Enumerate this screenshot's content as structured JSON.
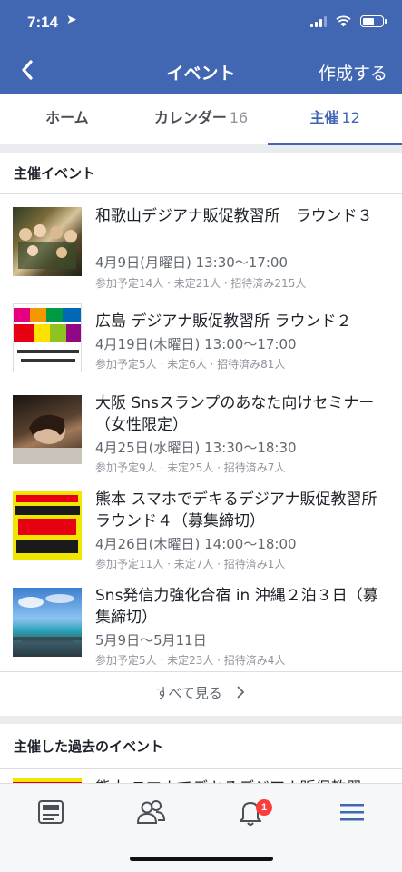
{
  "status": {
    "time": "7:14"
  },
  "nav": {
    "title": "イベント",
    "create": "作成する"
  },
  "tabs": [
    {
      "label": "ホーム",
      "count": ""
    },
    {
      "label": "カレンダー",
      "count": "16"
    },
    {
      "label": "主催",
      "count": "12"
    }
  ],
  "hosted": {
    "header": "主催イベント",
    "events": [
      {
        "title": "和歌山デジアナ販促教習所　ラウンド３",
        "date": "4月9日(月曜日) 13:30～17:00",
        "meta": "参加予定14人 · 未定21人 · 招待済み215人",
        "thumb_text": ""
      },
      {
        "title": "広島 デジアナ販促教習所 ラウンド２",
        "date": "4月19日(木曜日) 13:00～17:00",
        "meta": "参加予定5人 · 未定6人 · 招待済み81人",
        "thumb_text": "広島デジアナ販促教習所 Training School"
      },
      {
        "title": "大阪 Snsスランプのあなた向けセミナー（女性限定）",
        "date": "4月25日(水曜日) 13:30～18:30",
        "meta": "参加予定9人 · 未定25人 · 招待済み7人",
        "thumb_text": ""
      },
      {
        "title": "熊本 スマホでデキるデジアナ販促教習所 ラウンド４（募集締切）",
        "date": "4月26日(木曜日) 14:00～18:00",
        "meta": "参加予定11人 · 未定7人 · 招待済み1人",
        "thumb_text": "SNS初心者必見 スマホだけでできる簡単集客"
      },
      {
        "title": "Sns発信力強化合宿 in 沖縄２泊３日（募集締切）",
        "date": "5月9日～5月11日",
        "meta": "参加予定5人 · 未定23人 · 招待済み4人",
        "thumb_text": ""
      }
    ],
    "see_all": "すべて見る"
  },
  "past": {
    "header": "主催した過去のイベント",
    "partial_title": "熊本 スマホでデキるデジアナ販促教習"
  },
  "bottom_nav": {
    "notification_badge": "1",
    "icons": [
      "news-feed-icon",
      "friends-icon",
      "notifications-icon",
      "menu-icon"
    ]
  },
  "colors": {
    "brand": "#4267b2",
    "badge": "#fa3e3e"
  }
}
